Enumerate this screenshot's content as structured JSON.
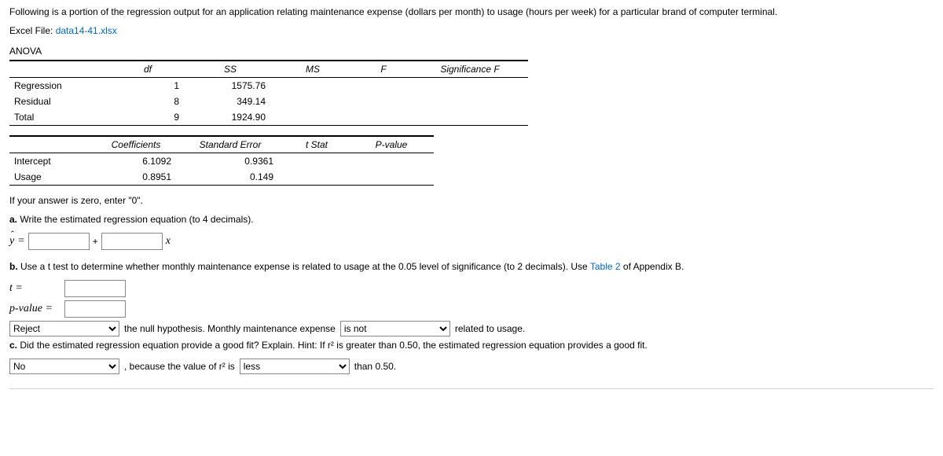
{
  "intro": "Following is a portion of the regression output for an application relating maintenance expense (dollars per month) to usage (hours per week) for a particular brand of computer terminal.",
  "file_label": "Excel File: ",
  "file_link": "data14-41.xlsx",
  "anova_label": "ANOVA",
  "anova_headers": {
    "c0": "",
    "c1": "df",
    "c2": "SS",
    "c3": "MS",
    "c4": "F",
    "c5": "Significance F"
  },
  "anova_rows": {
    "r0": {
      "label": "Regression",
      "df": "1",
      "ss": "1575.76"
    },
    "r1": {
      "label": "Residual",
      "df": "8",
      "ss": "349.14"
    },
    "r2": {
      "label": "Total",
      "df": "9",
      "ss": "1924.90"
    }
  },
  "coef_headers": {
    "c0": "",
    "c1": "Coefficients",
    "c2": "Standard Error",
    "c3": "t Stat",
    "c4": "P-value"
  },
  "coef_rows": {
    "r0": {
      "label": "Intercept",
      "coef": "6.1092",
      "se": "0.9361"
    },
    "r1": {
      "label": "Usage",
      "coef": "0.8951",
      "se": "0.149"
    }
  },
  "zero_note": "If your answer is zero, enter \"0\".",
  "qa_label": "a.",
  "qa_text": " Write the estimated regression equation (to 4 decimals).",
  "yhat": "ŷ",
  "equals": " = ",
  "plus": " + ",
  "x": "x",
  "qb_label": "b.",
  "qb_text": " Use a t test to determine whether monthly maintenance expense is related to usage at the 0.05 level of significance (to 2 decimals). Use ",
  "qb_link": "Table 2",
  "qb_text2": " of Appendix B.",
  "t_label": "t =",
  "p_label": "p-value =",
  "reject_opt": "Reject",
  "reject_tail1": " the null hypothesis. Monthly maintenance expense ",
  "isnot_opt": "is not",
  "reject_tail2": " related to usage.",
  "qc_label": "c.",
  "qc_text": " Did the estimated regression equation provide a good fit? Explain. Hint: If r² is greater than 0.50, the estimated regression equation provides a good fit.",
  "no_opt": "No",
  "qc_tail1": " , because the value of r² is ",
  "less_opt": "less",
  "qc_tail2": " than 0.50."
}
